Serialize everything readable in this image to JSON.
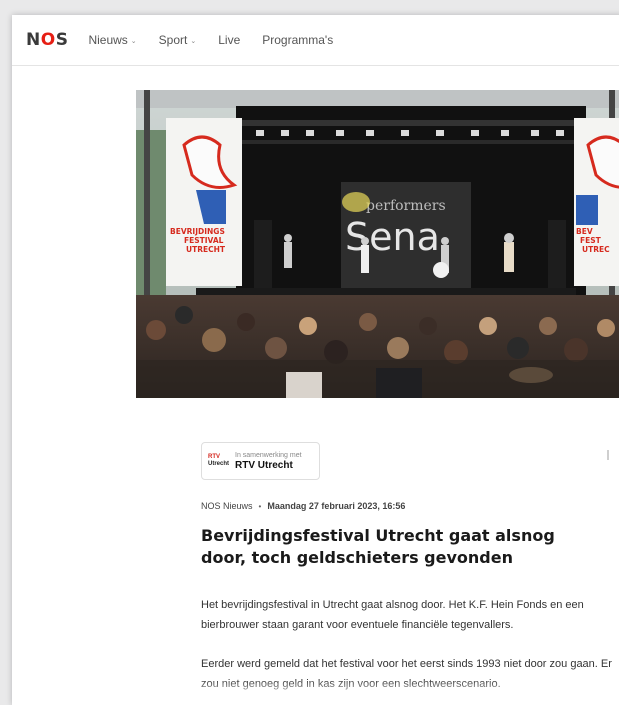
{
  "header": {
    "logo": "NOS",
    "menu": [
      {
        "label": "Nieuws",
        "dropdown": true
      },
      {
        "label": "Sport",
        "dropdown": true
      },
      {
        "label": "Live",
        "dropdown": false
      },
      {
        "label": "Programma's",
        "dropdown": false
      }
    ]
  },
  "hero": {
    "banner_text": [
      "BEVRIJDINGS",
      "FESTIVAL",
      "UTRECHT"
    ],
    "screen_top": "performers",
    "screen_main": "Sena"
  },
  "partner": {
    "intro": "In samenwerking met",
    "logo_top": "RTV",
    "logo_bottom": "Utrecht",
    "name": "RTV Utrecht"
  },
  "article": {
    "source": "NOS Nieuws",
    "separator": "•",
    "date": "Maandag 27 februari 2023, 16:56",
    "title": "Bevrijdingsfestival Utrecht gaat alsnog door, toch geldschieters gevonden",
    "paragraphs": [
      "Het bevrijdingsfestival in Utrecht gaat alsnog door. Het K.F. Hein Fonds en een bierbrouwer staan garant voor eventuele financiële tegenvallers.",
      "Eerder werd gemeld dat het festival voor het eerst sinds 1993 niet door zou gaan. Er zou niet genoeg geld in kas zijn voor een slechtweerscenario."
    ]
  },
  "colors": {
    "brand_red": "#e61e14",
    "text": "#1a1a1a",
    "banner_blue": "#2f5fb5",
    "banner_red": "#d62a1e"
  }
}
